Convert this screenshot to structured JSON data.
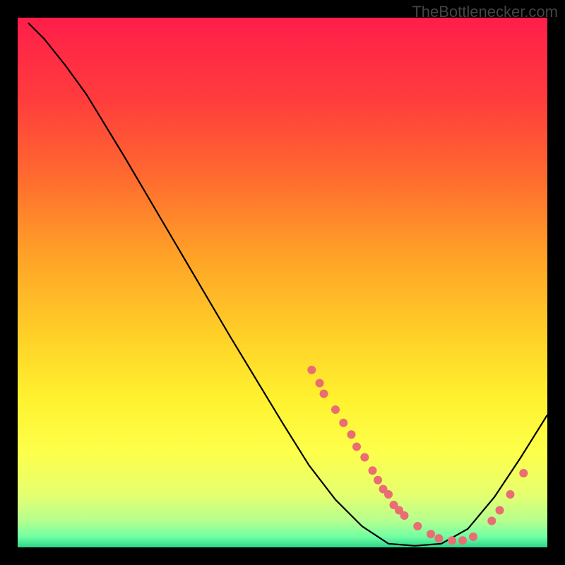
{
  "watermark": "TheBottlenecker.com",
  "chart_data": {
    "type": "line",
    "title": "",
    "xlabel": "",
    "ylabel": "",
    "xlim": [
      0,
      100
    ],
    "ylim": [
      0,
      100
    ],
    "curve_points": [
      {
        "x": 2,
        "y": 99
      },
      {
        "x": 5,
        "y": 96
      },
      {
        "x": 9,
        "y": 91
      },
      {
        "x": 13,
        "y": 85.5
      },
      {
        "x": 20,
        "y": 74
      },
      {
        "x": 30,
        "y": 57
      },
      {
        "x": 40,
        "y": 40
      },
      {
        "x": 50,
        "y": 23.5
      },
      {
        "x": 55,
        "y": 15.5
      },
      {
        "x": 60,
        "y": 9
      },
      {
        "x": 65,
        "y": 4
      },
      {
        "x": 70,
        "y": 0.7
      },
      {
        "x": 75,
        "y": 0.3
      },
      {
        "x": 80,
        "y": 0.7
      },
      {
        "x": 85,
        "y": 3.5
      },
      {
        "x": 90,
        "y": 9.5
      },
      {
        "x": 95,
        "y": 17
      },
      {
        "x": 100,
        "y": 25
      }
    ],
    "marker_points": [
      {
        "x": 55.5,
        "y": 33.5
      },
      {
        "x": 57,
        "y": 31
      },
      {
        "x": 57.8,
        "y": 29
      },
      {
        "x": 60,
        "y": 26
      },
      {
        "x": 61.5,
        "y": 23.5
      },
      {
        "x": 63,
        "y": 21.3
      },
      {
        "x": 64,
        "y": 19
      },
      {
        "x": 65.5,
        "y": 17
      },
      {
        "x": 67,
        "y": 14.5
      },
      {
        "x": 68,
        "y": 12.7
      },
      {
        "x": 69,
        "y": 11
      },
      {
        "x": 70,
        "y": 10
      },
      {
        "x": 71,
        "y": 8
      },
      {
        "x": 72,
        "y": 7
      },
      {
        "x": 73,
        "y": 6
      },
      {
        "x": 75.5,
        "y": 4
      },
      {
        "x": 78,
        "y": 2.5
      },
      {
        "x": 79.5,
        "y": 1.7
      },
      {
        "x": 82,
        "y": 1.3
      },
      {
        "x": 84,
        "y": 1.3
      },
      {
        "x": 86,
        "y": 2
      },
      {
        "x": 89.5,
        "y": 5
      },
      {
        "x": 91,
        "y": 7
      },
      {
        "x": 93,
        "y": 10
      },
      {
        "x": 95.5,
        "y": 14
      }
    ],
    "marker_color": "#e96d72",
    "curve_color": "#000000",
    "gradient_stops": [
      {
        "offset": 0,
        "color": "#ff1e4a"
      },
      {
        "offset": 15,
        "color": "#ff3b3d"
      },
      {
        "offset": 30,
        "color": "#ff6a2f"
      },
      {
        "offset": 45,
        "color": "#ffa227"
      },
      {
        "offset": 60,
        "color": "#ffd028"
      },
      {
        "offset": 72,
        "color": "#fff22f"
      },
      {
        "offset": 82,
        "color": "#fdff4a"
      },
      {
        "offset": 90,
        "color": "#e6ff6f"
      },
      {
        "offset": 95,
        "color": "#b5ff8f"
      },
      {
        "offset": 98,
        "color": "#71ffa3"
      },
      {
        "offset": 100,
        "color": "#2bd68a"
      }
    ]
  }
}
